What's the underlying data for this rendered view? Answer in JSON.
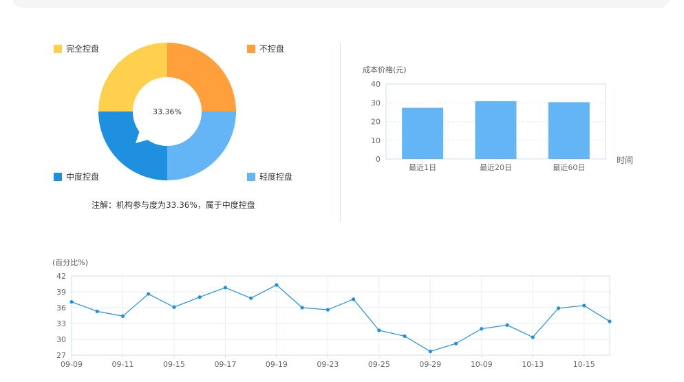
{
  "donut": {
    "center_label": "33.36%",
    "note": "注解：机构参与度为33.36%，属于中度控盘",
    "legend": [
      {
        "label": "完全控盘",
        "color": "#ffd04d"
      },
      {
        "label": "不控盘",
        "color": "#ffa03c"
      },
      {
        "label": "中度控盘",
        "color": "#1f8fe0"
      },
      {
        "label": "轻度控盘",
        "color": "#64b5f6"
      }
    ]
  },
  "cost_chart": {
    "y_unit": "成本价格(元)",
    "x_unit": "时间"
  },
  "line_chart": {
    "y_unit": "(百分比%)"
  },
  "chart_data": [
    {
      "type": "pie",
      "categories": [
        "不控盘",
        "轻度控盘",
        "中度控盘",
        "完全控盘"
      ],
      "values": [
        25,
        25,
        25,
        25
      ],
      "colors": [
        "#ffa03c",
        "#64b5f6",
        "#1f8fe0",
        "#ffd04d"
      ],
      "donut": true,
      "center_label": "33.36%"
    },
    {
      "type": "bar",
      "categories": [
        "最近1日",
        "最近20日",
        "最近60日"
      ],
      "values": [
        27.3,
        30.8,
        30.3
      ],
      "ylabel": "成本价格(元)",
      "xlabel": "时间",
      "ylim": [
        0,
        40
      ],
      "yticks": [
        0,
        10,
        20,
        30,
        40
      ],
      "color": "#64b5f6",
      "grid": true
    },
    {
      "type": "line",
      "x": [
        "09-09",
        "09-10",
        "09-11",
        "09-12",
        "09-15",
        "09-16",
        "09-17",
        "09-18",
        "09-19",
        "09-22",
        "09-23",
        "09-24",
        "09-25",
        "09-26",
        "09-29",
        "09-30",
        "10-09",
        "10-10",
        "10-13",
        "10-14",
        "10-15",
        "10-16"
      ],
      "values": [
        37.1,
        35.3,
        34.4,
        38.6,
        36.1,
        38.0,
        39.8,
        37.8,
        40.3,
        36.0,
        35.6,
        37.6,
        31.7,
        30.6,
        27.7,
        29.2,
        32.0,
        32.7,
        30.4,
        35.9,
        36.4,
        33.4
      ],
      "xticks": [
        "09-09",
        "09-11",
        "09-15",
        "09-17",
        "09-19",
        "09-23",
        "09-25",
        "09-29",
        "10-09",
        "10-13",
        "10-15"
      ],
      "ylabel": "(百分比%)",
      "ylim": [
        27,
        42
      ],
      "yticks": [
        27,
        30,
        33,
        36,
        39,
        42
      ],
      "color": "#1f8fe0",
      "grid": true
    }
  ]
}
